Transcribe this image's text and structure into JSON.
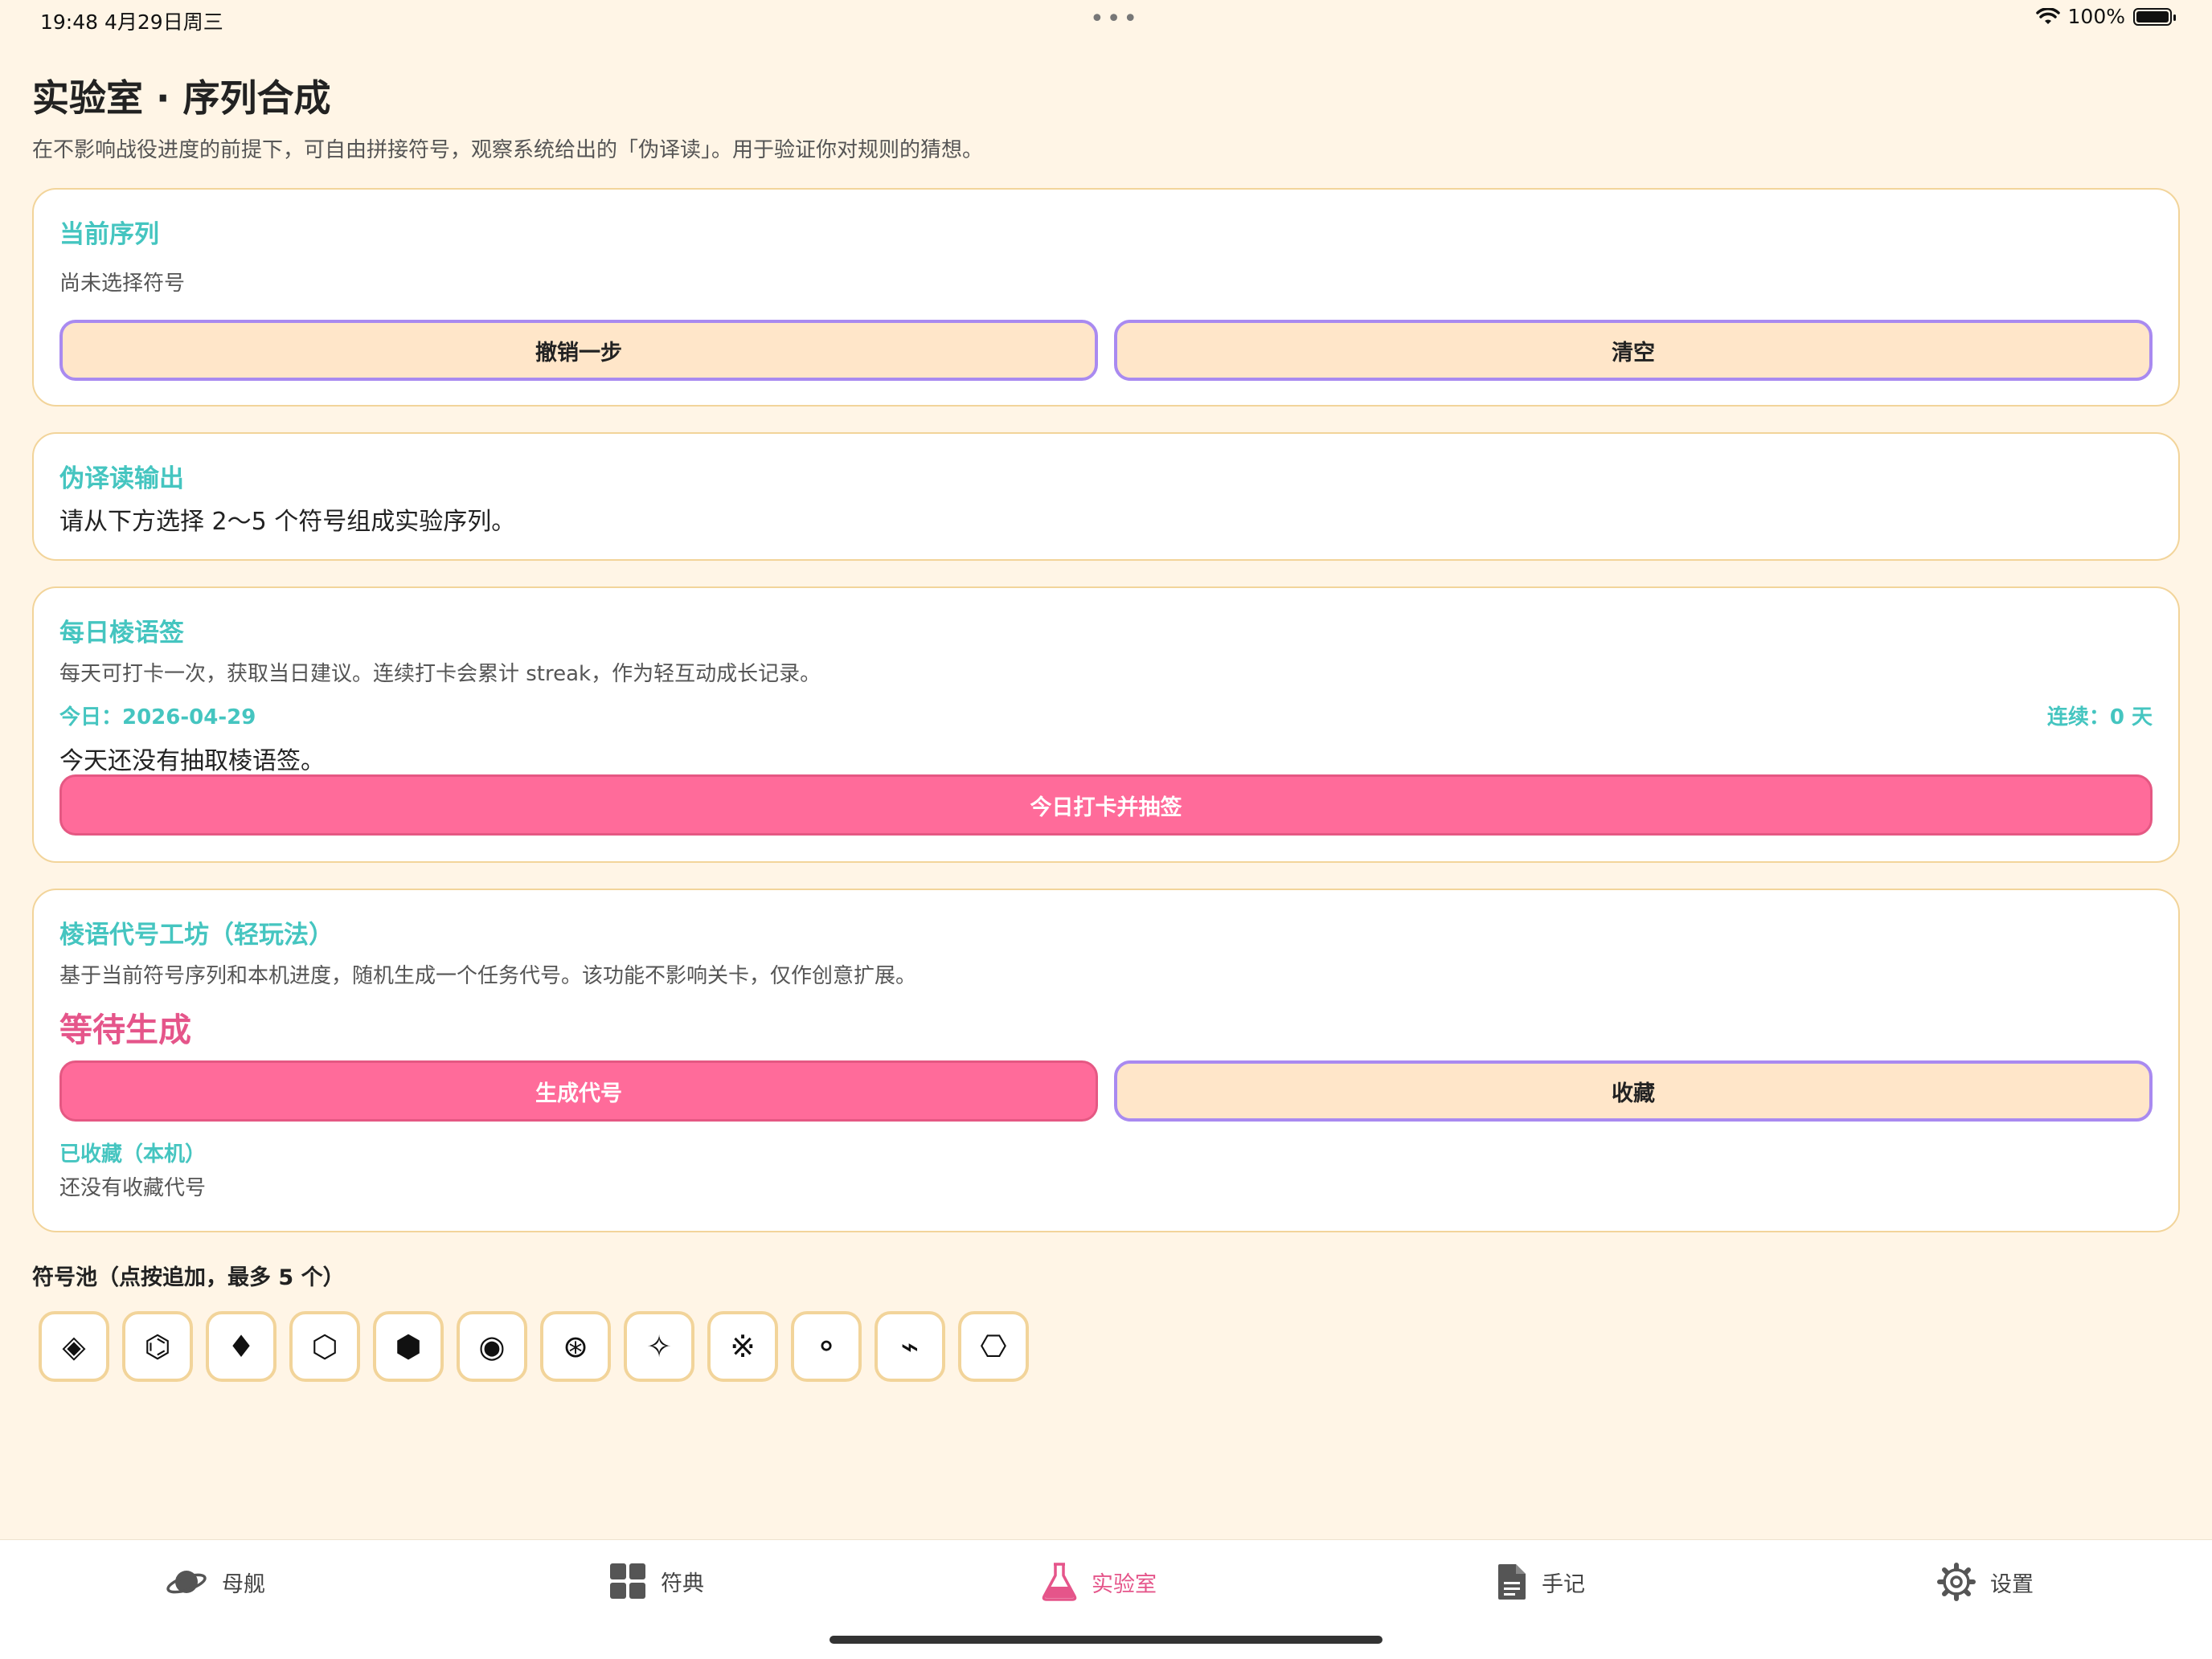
{
  "status": {
    "time_date": "19:48   4月29日周三",
    "battery": "100%"
  },
  "page": {
    "title": "实验室 · 序列合成",
    "subtitle": "在不影响战役进度的前提下，可自由拼接符号，观察系统给出的「伪译读」。用于验证你对规则的猜想。"
  },
  "sequence": {
    "title": "当前序列",
    "empty_text": "尚未选择符号",
    "undo_label": "撤销一步",
    "clear_label": "清空"
  },
  "pseudo": {
    "title": "伪译读输出",
    "text": "请从下方选择 2～5 个符号组成实验序列。"
  },
  "daily": {
    "title": "每日棱语签",
    "desc": "每天可打卡一次，获取当日建议。连续打卡会累计 streak，作为轻互动成长记录。",
    "today": "今日：2026-04-29",
    "streak": "连续：0 天",
    "status": "今天还没有抽取棱语签。",
    "button_label": "今日打卡并抽签"
  },
  "workshop": {
    "title": "棱语代号工坊（轻玩法）",
    "desc": "基于当前符号序列和本机进度，随机生成一个任务代号。该功能不影响关卡，仅作创意扩展。",
    "code": "等待生成",
    "generate_label": "生成代号",
    "save_label": "收藏",
    "saved_title": "已收藏（本机）",
    "saved_empty": "还没有收藏代号"
  },
  "pool": {
    "title": "符号池（点按追加，最多 5 个）",
    "symbols": [
      "◈",
      "⌬",
      "♦",
      "⬡",
      "⬢",
      "◉",
      "⊛",
      "✧",
      "※",
      "⚬",
      "⌁",
      "⎔"
    ]
  },
  "tabs": [
    {
      "label": "母舰",
      "icon": "planet-icon"
    },
    {
      "label": "符典",
      "icon": "grid-icon"
    },
    {
      "label": "实验室",
      "icon": "flask-icon"
    },
    {
      "label": "手记",
      "icon": "document-icon"
    },
    {
      "label": "设置",
      "icon": "gear-icon"
    }
  ],
  "colors": {
    "background": "#FFF5E6",
    "accent_teal": "#45C5C0",
    "accent_pink": "#FF6B9A",
    "card_border": "#F2D49A",
    "button_border": "#A98AF0"
  }
}
